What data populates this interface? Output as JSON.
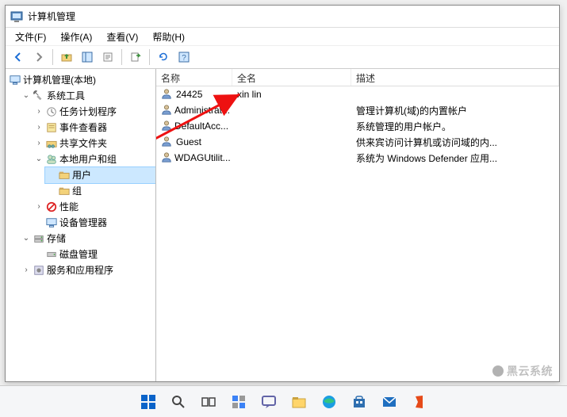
{
  "window": {
    "title": "计算机管理"
  },
  "menu": {
    "file": "文件(F)",
    "action": "操作(A)",
    "view": "查看(V)",
    "help": "帮助(H)"
  },
  "tree": {
    "root": "计算机管理(本地)",
    "system_tools": "系统工具",
    "task_scheduler": "任务计划程序",
    "event_viewer": "事件查看器",
    "shared_folders": "共享文件夹",
    "local_users_groups": "本地用户和组",
    "users": "用户",
    "groups": "组",
    "performance": "性能",
    "device_manager": "设备管理器",
    "storage": "存储",
    "disk_management": "磁盘管理",
    "services_apps": "服务和应用程序"
  },
  "columns": {
    "name": "名称",
    "fullname": "全名",
    "description": "描述"
  },
  "users": [
    {
      "name": "24425",
      "fullname": "xin lin",
      "description": ""
    },
    {
      "name": "Administrat...",
      "fullname": "",
      "description": "管理计算机(域)的内置帐户"
    },
    {
      "name": "DefaultAcc...",
      "fullname": "",
      "description": "系统管理的用户帐户。"
    },
    {
      "name": "Guest",
      "fullname": "",
      "description": "供来宾访问计算机或访问域的内..."
    },
    {
      "name": "WDAGUtilit...",
      "fullname": "",
      "description": "系统为 Windows Defender 应用..."
    }
  ],
  "watermark": "黑云系统"
}
